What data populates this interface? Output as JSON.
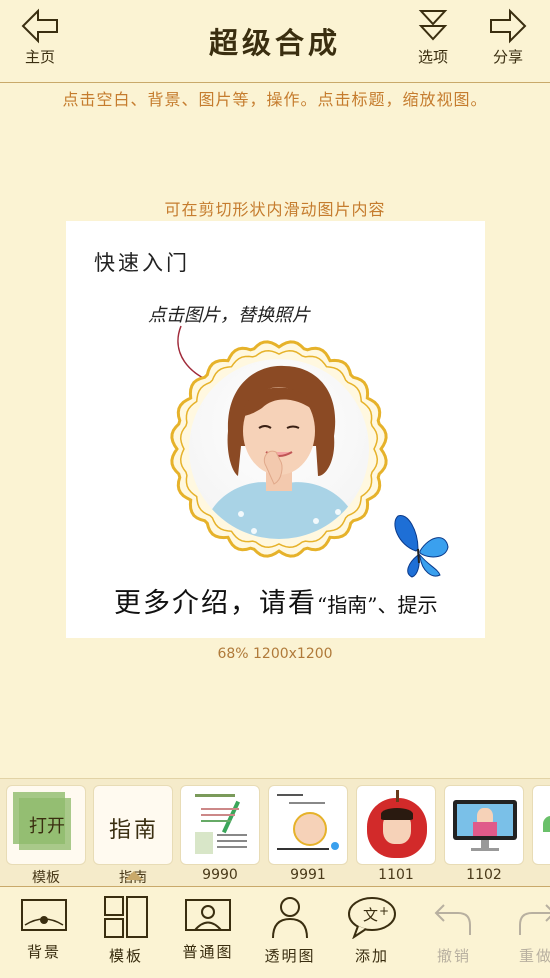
{
  "header": {
    "title": "超级合成",
    "home_label": "主页",
    "options_label": "选项",
    "share_label": "分享"
  },
  "hint": "点击空白、背景、图片等，操作。点击标题，缩放视图。",
  "crop_hint": "可在剪切形状内滑动图片内容",
  "canvas": {
    "title": "快速入门",
    "subtitle": "点击图片，替换照片",
    "more_main": "更多介绍，请看",
    "more_tail": "“指南”、提示"
  },
  "status": "68%  1200x1200",
  "thumbnails": [
    {
      "label": "模板",
      "inner": "打开"
    },
    {
      "label": "指南",
      "inner": "指南"
    },
    {
      "label": "9990"
    },
    {
      "label": "9991"
    },
    {
      "label": "1101"
    },
    {
      "label": "1102"
    }
  ],
  "toolbar": [
    {
      "label": "背景",
      "icon": "background-icon"
    },
    {
      "label": "模板",
      "icon": "template-icon"
    },
    {
      "label": "普通图",
      "icon": "normal-image-icon"
    },
    {
      "label": "透明图",
      "icon": "transparent-image-icon"
    },
    {
      "label": "添加",
      "icon": "add-text-icon"
    },
    {
      "label": "撤销",
      "icon": "undo-icon"
    },
    {
      "label": "重做",
      "icon": "redo-icon"
    }
  ],
  "colors": {
    "background": "#fbf3d3",
    "accent": "#c57c2e",
    "frame_gold": "#e6b22a"
  }
}
